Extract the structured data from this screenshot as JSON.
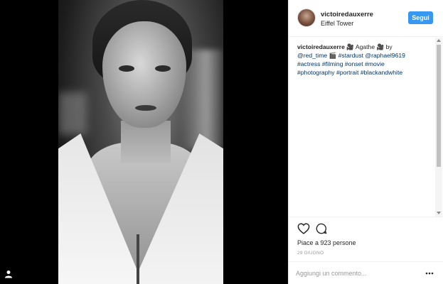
{
  "header": {
    "username": "victoiredauxerre",
    "location": "Eiffel Tower",
    "follow_label": "Segui"
  },
  "caption": {
    "user": "victoiredauxerre",
    "text1": " 🎥 Agathe 🎥 by ",
    "mention1": "@red_time",
    "text2": " 🎬 ",
    "tag1": "#stardust",
    "text3": " ",
    "mention2": "@raphael9619",
    "text4": " ",
    "tag2": "#actress",
    "tag3": "#filming",
    "tag4": "#onset",
    "tag5": "#movie",
    "tag6": "#photography",
    "tag7": "#portrait",
    "tag8": "#blackandwhite"
  },
  "actions": {
    "likes": "Piace a 923 persone",
    "date": "29 GIUGNO"
  },
  "comment": {
    "placeholder": "Aggiungi un commento..."
  },
  "icons": {
    "heart": "heart-icon",
    "comment": "comment-icon",
    "more": "more-options-icon",
    "user_tag": "user-tag-icon"
  },
  "colors": {
    "follow_button": "#3897f0",
    "link": "#003569",
    "text": "#262626"
  }
}
